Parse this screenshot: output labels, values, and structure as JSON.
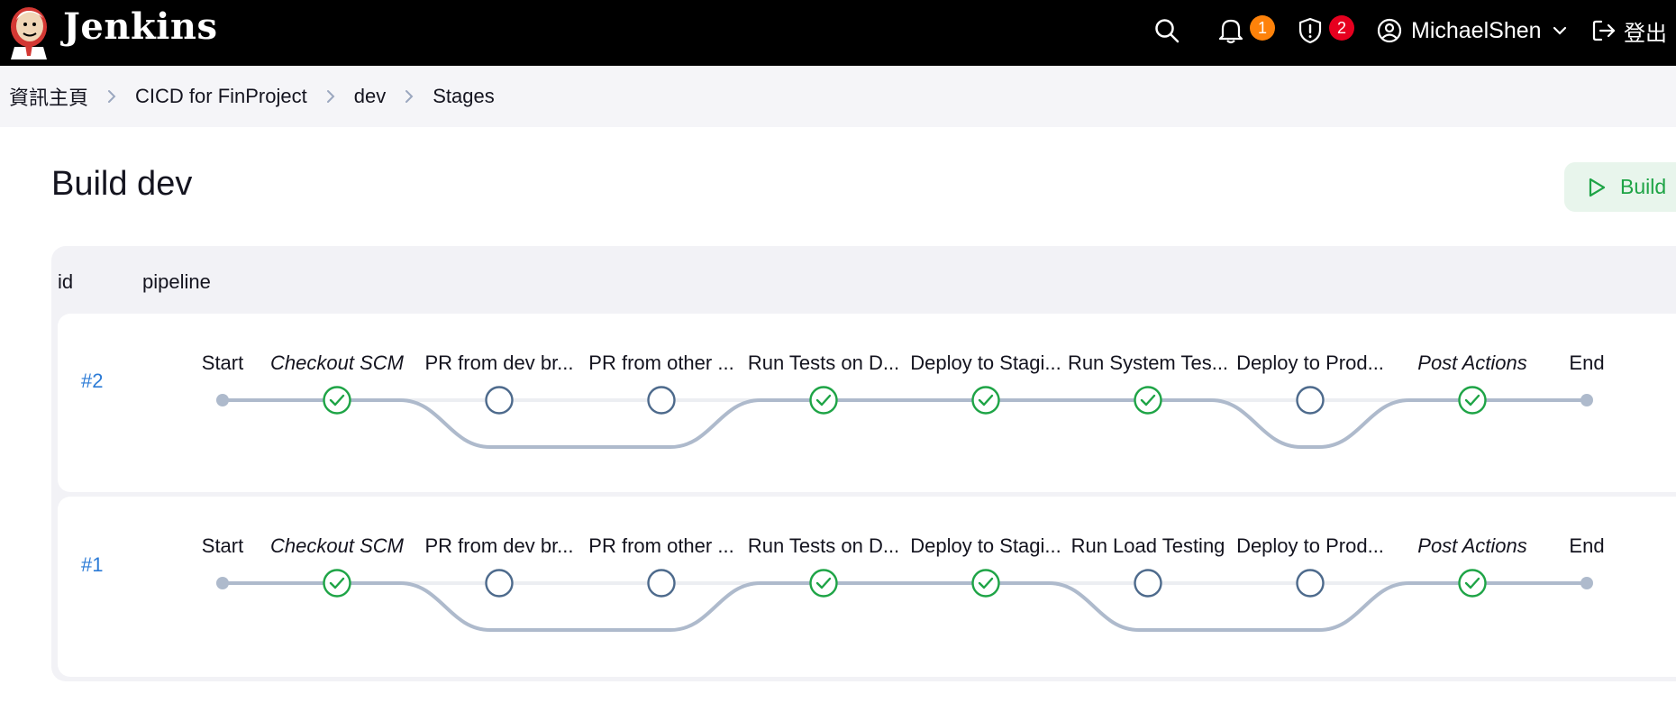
{
  "header": {
    "brand": "Jenkins",
    "notifications_count": "1",
    "security_count": "2",
    "user_name": "MichaelShen",
    "logout_label": "登出"
  },
  "breadcrumb": [
    "資訊主頁",
    "CICD for FinProject",
    "dev",
    "Stages"
  ],
  "page": {
    "title": "Build dev",
    "build_button": "Build"
  },
  "table": {
    "col_id": "id",
    "col_pipeline": "pipeline"
  },
  "runs": [
    {
      "id": "#2",
      "stages": [
        {
          "label": "Start",
          "kind": "endpoint",
          "italic": false,
          "branch": false
        },
        {
          "label": "Checkout SCM",
          "kind": "success",
          "italic": true,
          "branch": false
        },
        {
          "label": "PR from dev br...",
          "kind": "skipped",
          "italic": false,
          "branch": true
        },
        {
          "label": "PR from other ...",
          "kind": "skipped",
          "italic": false,
          "branch": true
        },
        {
          "label": "Run Tests on D...",
          "kind": "success",
          "italic": false,
          "branch": false
        },
        {
          "label": "Deploy to Stagi...",
          "kind": "success",
          "italic": false,
          "branch": false
        },
        {
          "label": "Run System Tes...",
          "kind": "success",
          "italic": false,
          "branch": false
        },
        {
          "label": "Deploy to Prod...",
          "kind": "skipped",
          "italic": false,
          "branch": true
        },
        {
          "label": "Post Actions",
          "kind": "success",
          "italic": true,
          "branch": false
        },
        {
          "label": "End",
          "kind": "endpoint",
          "italic": false,
          "branch": false
        }
      ]
    },
    {
      "id": "#1",
      "stages": [
        {
          "label": "Start",
          "kind": "endpoint",
          "italic": false,
          "branch": false
        },
        {
          "label": "Checkout SCM",
          "kind": "success",
          "italic": true,
          "branch": false
        },
        {
          "label": "PR from dev br...",
          "kind": "skipped",
          "italic": false,
          "branch": true
        },
        {
          "label": "PR from other ...",
          "kind": "skipped",
          "italic": false,
          "branch": true
        },
        {
          "label": "Run Tests on D...",
          "kind": "success",
          "italic": false,
          "branch": false
        },
        {
          "label": "Deploy to Stagi...",
          "kind": "success",
          "italic": false,
          "branch": false
        },
        {
          "label": "Run Load Testing",
          "kind": "skipped",
          "italic": false,
          "branch": true
        },
        {
          "label": "Deploy to Prod...",
          "kind": "skipped",
          "italic": false,
          "branch": true
        },
        {
          "label": "Post Actions",
          "kind": "success",
          "italic": true,
          "branch": false
        },
        {
          "label": "End",
          "kind": "endpoint",
          "italic": false,
          "branch": false
        }
      ]
    }
  ],
  "colors": {
    "success": "#1ea446",
    "skipped": "#4d6a8c",
    "track": "#aebacc",
    "link": "#2c7bd6"
  }
}
